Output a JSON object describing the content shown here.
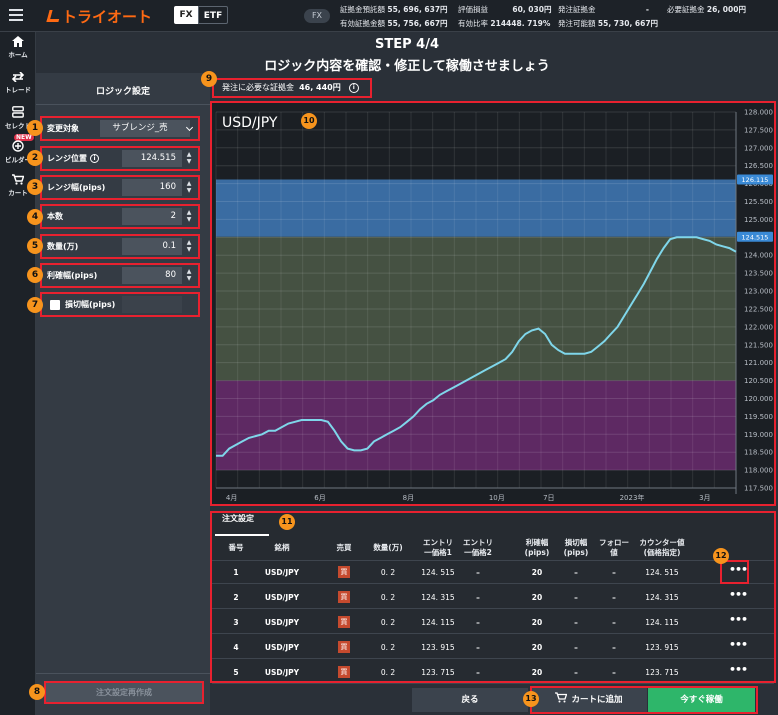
{
  "app": {
    "logo": "トライオート"
  },
  "header": {
    "segments": [
      "FX",
      "ETF"
    ],
    "account_mode": "FX",
    "stats": [
      {
        "label": "証拠金預託額",
        "value": "55, 696, 637円"
      },
      {
        "label": "評価損益",
        "value": "60, 030円"
      },
      {
        "label": "発注証拠金",
        "value": "-"
      },
      {
        "label": "必要証拠金",
        "value": "26, 000円"
      },
      {
        "label": "有効証拠金額",
        "value": "55, 756, 667円"
      },
      {
        "label": "有効比率",
        "value": "214448. 719%"
      },
      {
        "label": "発注可能額",
        "value": "55, 730, 667円"
      }
    ]
  },
  "nav": {
    "items": [
      "ホーム",
      "トレード",
      "セレクト",
      "ビルダー",
      "カート"
    ],
    "new_badge": "NEW"
  },
  "page": {
    "step": "STEP 4/4",
    "subtitle": "ロジック内容を確認・修正して稼働させましょう"
  },
  "logic": {
    "title": "ロジック設定",
    "fields": [
      {
        "label": "変更対象",
        "value": "サブレンジ_売"
      },
      {
        "label": "レンジ位置",
        "value": "124.515"
      },
      {
        "label": "レンジ幅(pips)",
        "value": "160"
      },
      {
        "label": "本数",
        "value": "2"
      },
      {
        "label": "数量(万)",
        "value": "0.1"
      },
      {
        "label": "利確幅(pips)",
        "value": "80"
      },
      {
        "label": "損切幅(pips)",
        "value": ""
      }
    ],
    "regen_button": "注文設定再作成"
  },
  "margin": {
    "label": "発注に必要な証拠金",
    "value": "46, 440円"
  },
  "badges": [
    "1",
    "2",
    "3",
    "4",
    "5",
    "6",
    "7",
    "8",
    "9",
    "10",
    "11",
    "12",
    "13"
  ],
  "chart_data": {
    "type": "line",
    "title": "USD/JPY",
    "y_ticks": [
      "128.000",
      "127.500",
      "127.000",
      "126.500",
      "126.000",
      "125.500",
      "125.000",
      "124.500",
      "124.000",
      "123.500",
      "123.000",
      "122.500",
      "122.000",
      "121.500",
      "121.000",
      "120.500",
      "120.000",
      "119.500",
      "119.000",
      "118.500",
      "118.000",
      "117.500"
    ],
    "ylim": [
      117.5,
      128.0
    ],
    "x_ticks": [
      "4月",
      "6月",
      "8月",
      "10月",
      "7日",
      "2023年",
      "3月"
    ],
    "price_labels": [
      "126.115",
      "124.515"
    ],
    "bands": [
      {
        "from": 124.515,
        "to": 126.115,
        "color": "#3f7ab8"
      },
      {
        "from": 120.5,
        "to": 124.515,
        "color": "#4c5a48"
      },
      {
        "from": 118.0,
        "to": 120.5,
        "color": "#6a2c6e"
      }
    ],
    "series": [
      {
        "values": [
          118.4,
          118.4,
          118.6,
          118.7,
          118.8,
          118.9,
          118.95,
          119.0,
          119.1,
          119.1,
          119.2,
          119.3,
          119.35,
          119.4,
          119.4,
          119.4,
          119.4,
          119.35,
          119.1,
          118.8,
          118.6,
          118.55,
          118.55,
          118.6,
          118.8,
          118.9,
          119.0,
          119.1,
          119.2,
          119.35,
          119.5,
          119.7,
          119.85,
          119.95,
          120.1,
          120.2,
          120.3,
          120.4,
          120.5,
          120.6,
          120.7,
          120.8,
          120.9,
          121.0,
          121.1,
          121.3,
          121.6,
          121.8,
          121.9,
          121.95,
          121.8,
          121.5,
          121.35,
          121.25,
          121.25,
          121.25,
          121.25,
          121.3,
          121.45,
          121.6,
          121.8,
          122.0,
          122.3,
          122.6,
          122.9,
          123.2,
          123.55,
          123.9,
          124.2,
          124.45,
          124.5,
          124.5,
          124.5,
          124.5,
          124.45,
          124.4,
          124.3,
          124.25,
          124.2,
          124.1
        ]
      }
    ]
  },
  "orders": {
    "tab": "注文設定",
    "headers": [
      "番号",
      "銘柄",
      "売買",
      "数量(万)",
      "エントリ\n一価格1",
      "エントリ\n一価格2",
      "利確幅\n(pips)",
      "損切幅\n(pips)",
      "フォロー\n値",
      "カウンター値\n(価格指定)",
      ""
    ],
    "side_label": "買",
    "rows": [
      {
        "no": "1",
        "pair": "USD/JPY",
        "qty": "0. 2",
        "entry1": "124. 515",
        "entry2": "–",
        "tp": "20",
        "sl": "–",
        "follow": "–",
        "counter": "124. 515",
        "menu": "•••"
      },
      {
        "no": "2",
        "pair": "USD/JPY",
        "qty": "0. 2",
        "entry1": "124. 315",
        "entry2": "–",
        "tp": "20",
        "sl": "–",
        "follow": "–",
        "counter": "124. 315",
        "menu": "•••"
      },
      {
        "no": "3",
        "pair": "USD/JPY",
        "qty": "0. 2",
        "entry1": "124. 115",
        "entry2": "–",
        "tp": "20",
        "sl": "–",
        "follow": "–",
        "counter": "124. 115",
        "menu": "•••"
      },
      {
        "no": "4",
        "pair": "USD/JPY",
        "qty": "0. 2",
        "entry1": "123. 915",
        "entry2": "–",
        "tp": "20",
        "sl": "–",
        "follow": "–",
        "counter": "123. 915",
        "menu": "•••"
      },
      {
        "no": "5",
        "pair": "USD/JPY",
        "qty": "0. 2",
        "entry1": "123. 715",
        "entry2": "–",
        "tp": "20",
        "sl": "–",
        "follow": "–",
        "counter": "123. 715",
        "menu": "•••"
      }
    ]
  },
  "footer": {
    "back": "戻る",
    "add_cart": "カートに追加",
    "run_now": "今すぐ稼働"
  }
}
